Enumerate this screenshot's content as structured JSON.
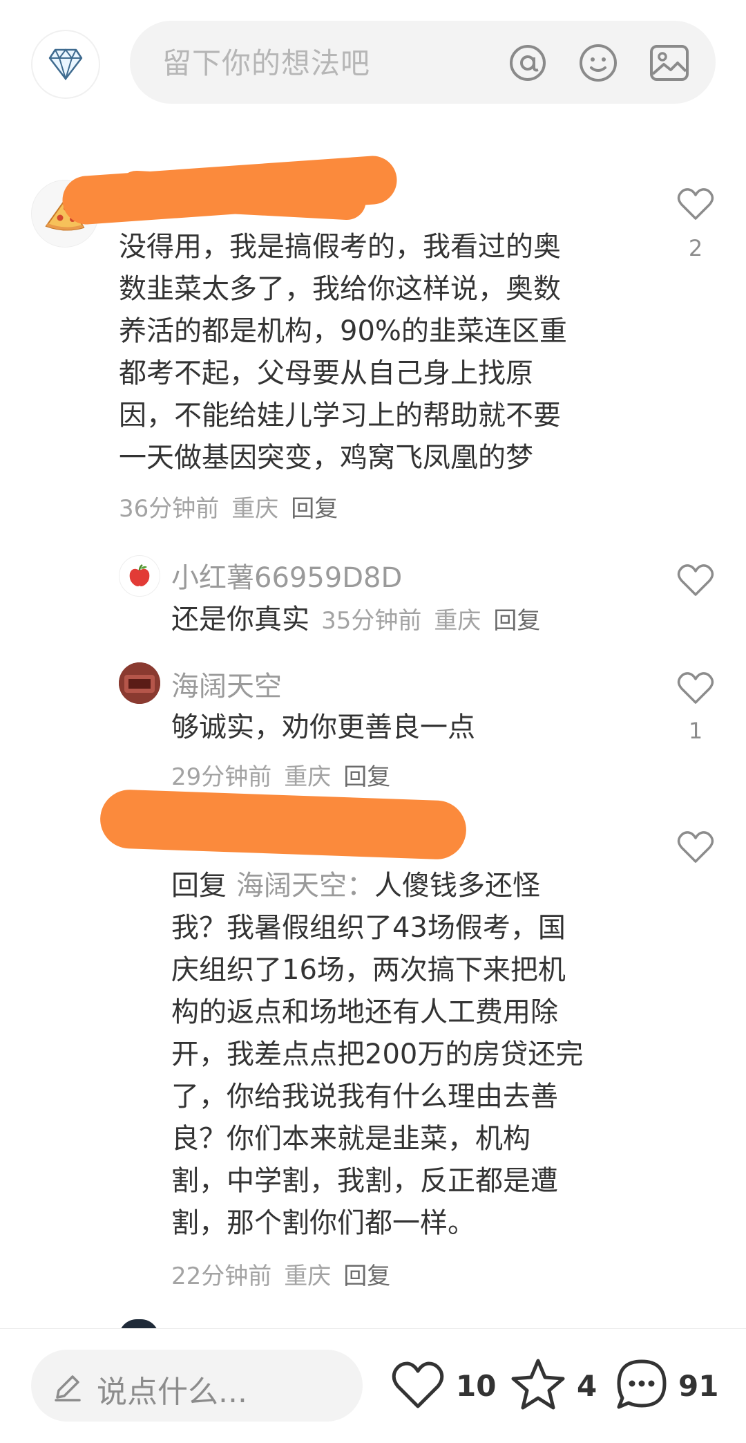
{
  "top": {
    "placeholder": "留下你的想法吧",
    "icons": [
      "diamond-icon",
      "at-icon",
      "emoji-icon",
      "image-icon"
    ]
  },
  "comments": [
    {
      "text_lines": [
        "没得用，我是搞假考的，我看过的奥",
        "数韭菜太多了，我给你这样说，奥数",
        "养活的都是机构，90%的韭菜连区重",
        "都考不起，父母要从自己身上找原",
        "因，不能给娃儿学习上的帮助就不要",
        "一天做基因突变，鸡窝飞凤凰的梦"
      ],
      "time": "36分钟前",
      "location": "重庆",
      "reply": "回复",
      "likes": "2"
    },
    {
      "author": "小红薯66959D8D",
      "text": "还是你真实",
      "time": "35分钟前",
      "location": "重庆",
      "reply": "回复"
    },
    {
      "author": "海阔天空",
      "text": "够诚实，劝你更善良一点",
      "time": "29分钟前",
      "location": "重庆",
      "reply": "回复",
      "likes": "1"
    },
    {
      "reply_prefix": "回复",
      "reply_to": "海阔天空：",
      "first_line_rest": "人傻钱多还怪",
      "text_lines": [
        "我？我暑假组织了43场假考，国",
        "庆组织了16场，两次搞下来把机",
        "构的返点和场地还有人工费用除",
        "开，我差点点把200万的房贷还完",
        "了，你给我说我有什么理由去善",
        "良？你们本来就是韭菜，机构",
        "割，中学割，我割，反正都是遭",
        "割，那个割你们都一样。"
      ],
      "time": "22分钟前",
      "location": "重庆",
      "reply": "回复"
    }
  ],
  "bottom": {
    "placeholder": "说点什么...",
    "likes": "10",
    "stars": "4",
    "comments": "91"
  },
  "colors": {
    "redaction": "#fb8a3c",
    "muted_text": "#9a9a9a",
    "body_text": "#333333"
  }
}
